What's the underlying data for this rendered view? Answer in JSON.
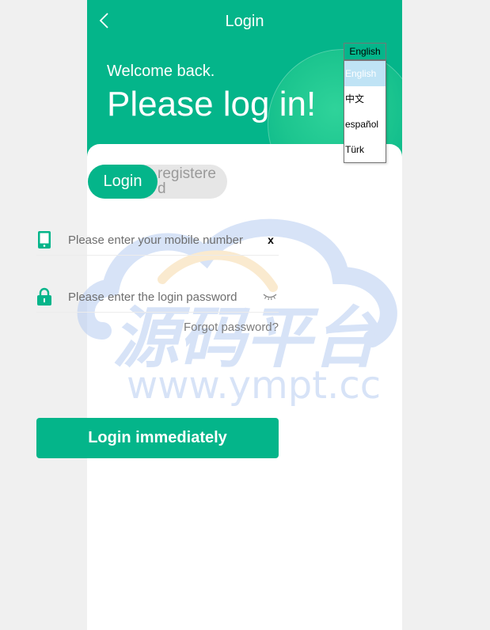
{
  "header": {
    "title": "Login",
    "back_icon": "chevron-left-icon"
  },
  "hero": {
    "welcome": "Welcome back.",
    "headline": "Please log in!"
  },
  "tabs": {
    "login": "Login",
    "register": "registered"
  },
  "form": {
    "mobile": {
      "placeholder": "Please enter your mobile number",
      "value": "",
      "icon": "phone-icon",
      "clear_label": "x"
    },
    "password": {
      "placeholder": "Please enter the login password",
      "value": "",
      "icon": "lock-icon",
      "eye_icon": "eye-closed-icon"
    },
    "forgot_label": "Forgot password?",
    "submit_label": "Login immediately"
  },
  "language": {
    "selected": "English",
    "options": [
      "English",
      "中文",
      "español",
      "Türk"
    ]
  },
  "watermark": {
    "cn": "源码平台",
    "url": "www.ympt.cc"
  },
  "colors": {
    "brand": "#04b58a",
    "tab_inactive": "#e6e6e6",
    "option_highlight": "#bfe3f5"
  }
}
